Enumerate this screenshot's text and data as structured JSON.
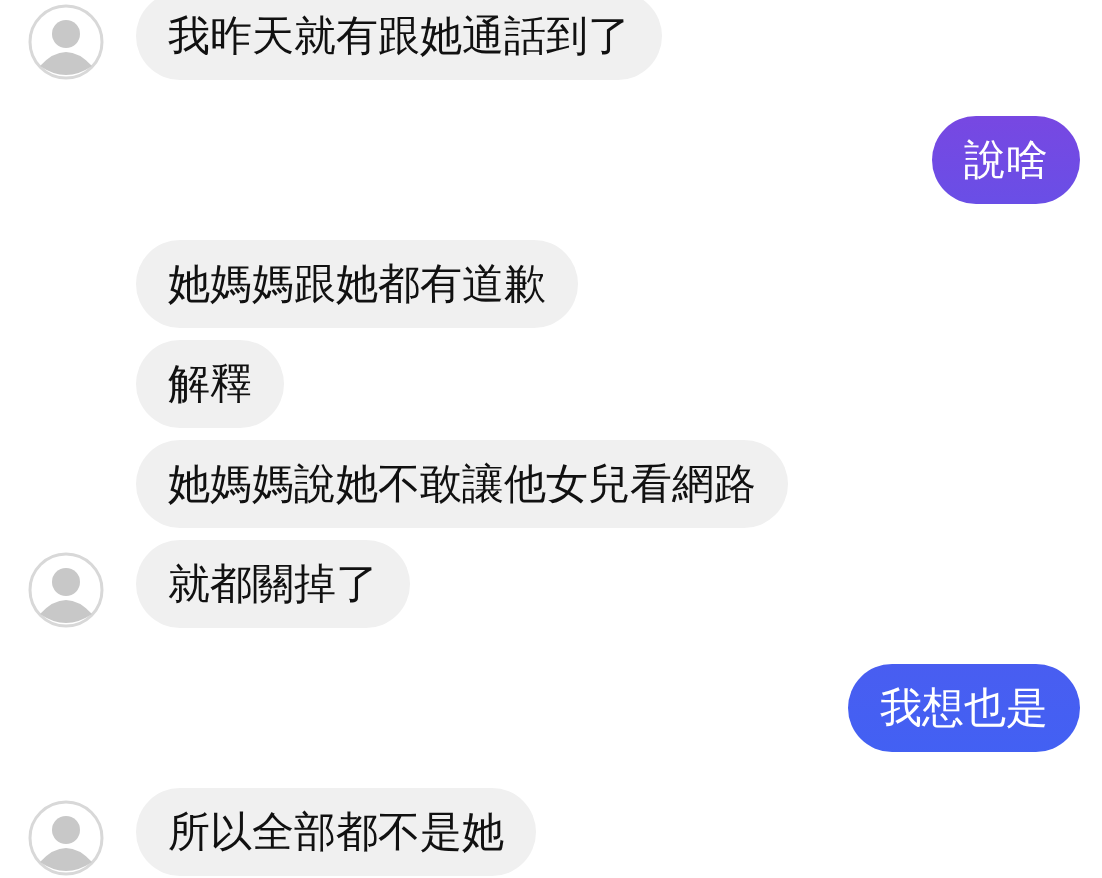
{
  "messages": [
    {
      "kind": "incoming",
      "text": "我昨天就有跟她通話到了",
      "avatar": true
    },
    {
      "kind": "outgoing",
      "text": "說啥",
      "avatar": false
    },
    {
      "kind": "incoming",
      "text": "她媽媽跟她都有道歉",
      "avatar": false
    },
    {
      "kind": "incoming",
      "text": "解釋",
      "avatar": false
    },
    {
      "kind": "incoming",
      "text": "她媽媽說她不敢讓他女兒看網路",
      "avatar": false
    },
    {
      "kind": "incoming",
      "text": "就都關掉了",
      "avatar": true
    },
    {
      "kind": "outgoing",
      "text": "我想也是",
      "avatar": false
    },
    {
      "kind": "incoming",
      "text": "所以全部都不是她",
      "avatar": true
    }
  ]
}
